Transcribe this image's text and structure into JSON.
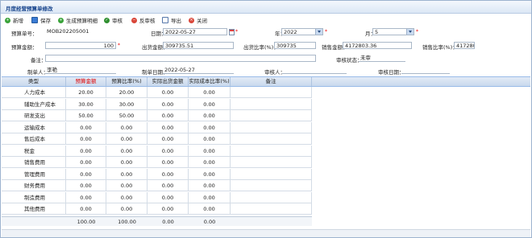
{
  "window": {
    "title": "月度经营预算单修改"
  },
  "toolbar": {
    "new_label": "新增",
    "save_label": "保存",
    "generate_label": "生成预算明细",
    "audit_label": "审核",
    "unaudit_label": "反审核",
    "export_label": "导出",
    "close_label": "关闭"
  },
  "form": {
    "budget_no_label": "预算单号：",
    "budget_no_value": "MOB202205001",
    "date_label": "日期：",
    "date_value": "2022-05-27",
    "year_label": "年：",
    "year_value": "2022",
    "month_label": "月：",
    "month_value": "5",
    "budget_amount_label": "预算金额：",
    "budget_amount_value": "100",
    "shipment_amount_label": "出货金额：",
    "shipment_amount_value": "309735.51",
    "shipment_ratio_label": "出货比率(%)：",
    "shipment_ratio_value": "309735",
    "sales_amount_label": "销售金额：",
    "sales_amount_value": "4172803.36",
    "sales_ratio_label": "销售比率(%)：",
    "sales_ratio_value": "417280",
    "remark_label": "备注：",
    "remark_value": "",
    "audit_status_label": "审核状态：",
    "audit_status_value": "未审",
    "maker_label": "制单人：",
    "maker_value": "李艳",
    "make_date_label": "制单日期：",
    "make_date_value": "2022-05-27",
    "auditor_label": "审核人：",
    "auditor_value": "",
    "audit_date_label": "审核日期：",
    "audit_date_value": ""
  },
  "grid": {
    "headers": [
      "类型",
      "预算金额",
      "预算比率(%)",
      "实际出货金额",
      "实际成本比率(%)",
      "备注"
    ],
    "rows": [
      [
        "人力成本",
        "20.00",
        "20.00",
        "0.00",
        "0.00",
        ""
      ],
      [
        "辅助生产成本",
        "30.00",
        "30.00",
        "0.00",
        "0.00",
        ""
      ],
      [
        "研发支出",
        "50.00",
        "50.00",
        "0.00",
        "0.00",
        ""
      ],
      [
        "运输成本",
        "0.00",
        "0.00",
        "0.00",
        "0.00",
        ""
      ],
      [
        "售后成本",
        "0.00",
        "0.00",
        "0.00",
        "0.00",
        ""
      ],
      [
        "税金",
        "0.00",
        "0.00",
        "0.00",
        "0.00",
        ""
      ],
      [
        "销售费用",
        "0.00",
        "0.00",
        "0.00",
        "0.00",
        ""
      ],
      [
        "管理费用",
        "0.00",
        "0.00",
        "0.00",
        "0.00",
        ""
      ],
      [
        "财务费用",
        "0.00",
        "0.00",
        "0.00",
        "0.00",
        ""
      ],
      [
        "制造费用",
        "0.00",
        "0.00",
        "0.00",
        "0.00",
        ""
      ],
      [
        "其他费用",
        "0.00",
        "0.00",
        "0.00",
        "0.00",
        ""
      ]
    ],
    "totals": [
      "",
      "100.00",
      "100.00",
      "0.00",
      "0.00",
      ""
    ]
  },
  "colors": {
    "accent": "#15428b",
    "budget_header": "#e00000",
    "required": "#e00000"
  }
}
